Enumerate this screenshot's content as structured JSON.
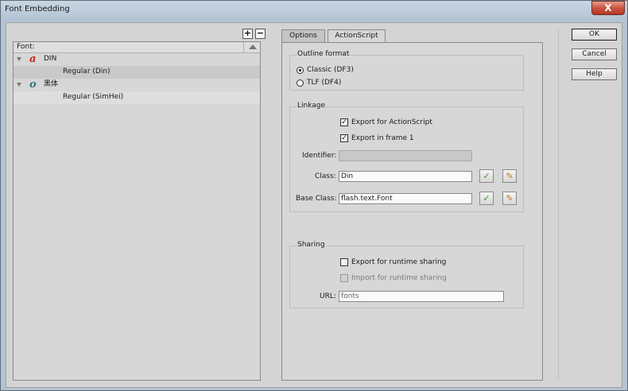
{
  "window": {
    "title": "Font Embedding",
    "close_label": "X"
  },
  "font_list": {
    "add_label": "+",
    "remove_label": "−",
    "header": "Font:",
    "families": [
      {
        "icon": "font-a-icon",
        "glyph": "a",
        "glyph_color": "#c8201c",
        "name": "DIN",
        "face": "Regular (Din)"
      },
      {
        "icon": "font-o-icon",
        "glyph": "o",
        "glyph_color": "#2e7a82",
        "name": "黑体",
        "face": "Regular (SimHei)"
      }
    ]
  },
  "tabs": {
    "options": "Options",
    "actionscript": "ActionScript"
  },
  "outline": {
    "title": "Outline format",
    "classic": "Classic (DF3)",
    "tlf": "TLF (DF4)",
    "selected": "classic"
  },
  "linkage": {
    "title": "Linkage",
    "export_as": "Export for ActionScript",
    "export_as_checked": true,
    "export_frame1": "Export in frame 1",
    "export_frame1_checked": true,
    "identifier_label": "Identifier:",
    "identifier_value": "",
    "class_label": "Class:",
    "class_value": "Din",
    "base_class_label": "Base Class:",
    "base_class_value": "flash.text.Font"
  },
  "sharing": {
    "title": "Sharing",
    "export_runtime": "Export for runtime sharing",
    "export_runtime_checked": false,
    "import_runtime": "Import for runtime sharing",
    "import_runtime_checked": false,
    "url_label": "URL:",
    "url_value": "fonts"
  },
  "buttons": {
    "ok": "OK",
    "cancel": "Cancel",
    "help": "Help"
  },
  "check_mark": "✓",
  "pencil_glyph": "✎"
}
